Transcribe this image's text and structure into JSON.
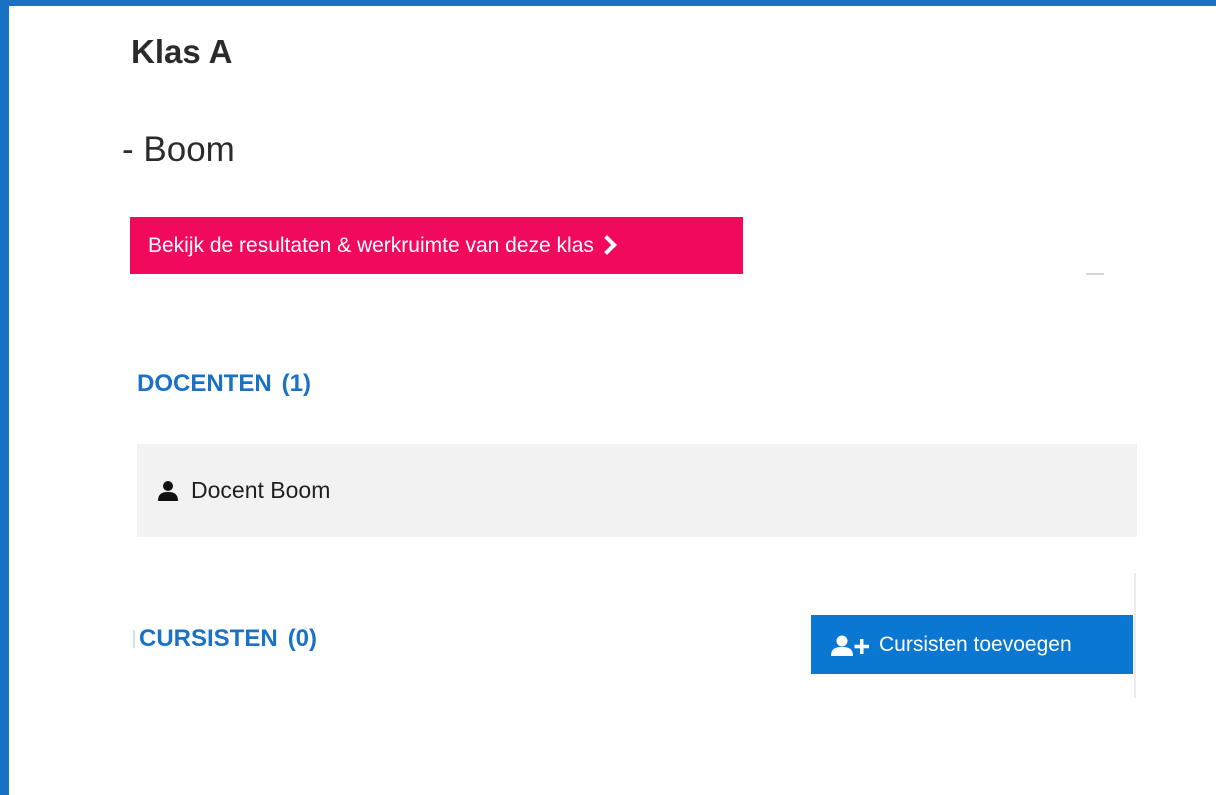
{
  "header": {
    "title": "Klas A",
    "subtitle": "- Boom"
  },
  "actions": {
    "results_label": "Bekijk de resultaten & werkruimte van deze klas"
  },
  "docenten": {
    "label": "DOCENTEN",
    "count": "(1)",
    "members": [
      {
        "name": "Docent Boom",
        "icon": "user-icon"
      }
    ]
  },
  "cursisten": {
    "label": "CURSISTEN",
    "count": "(0)",
    "add_label": "Cursisten toevoegen",
    "add_icon": "add-user-icon"
  },
  "colors": {
    "frame": "#1a72c6",
    "accent_pink": "#f0095c",
    "heading_blue": "#1a72c6",
    "button_blue": "#0a78d2",
    "row_background": "#f2f2f2"
  }
}
